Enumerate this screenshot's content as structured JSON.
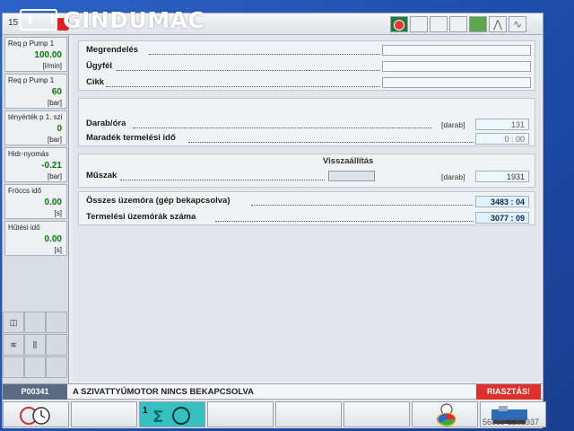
{
  "brand": {
    "logo_text": "GINDUMAC"
  },
  "topbar": {
    "time": "15"
  },
  "sidebar": {
    "items": [
      {
        "label": "Req p Pump 1",
        "value": "100.00",
        "unit": "[l/min]"
      },
      {
        "label": "Req p Pump 1",
        "value": "60",
        "unit": "[bar]"
      },
      {
        "label": "tényérték p 1. szi",
        "value": "0",
        "unit": "[bar]"
      },
      {
        "label": "Hidr-nyomás",
        "value": "-0.21",
        "unit": "[bar]"
      },
      {
        "label": "Fröccs idő",
        "value": "0.00",
        "unit": "[s]"
      },
      {
        "label": "Hűtési idő",
        "value": "0.00",
        "unit": "[s]"
      }
    ]
  },
  "main": {
    "order": {
      "megrendeles": "Megrendelés",
      "ugyfel": "Ügyfél",
      "cikk": "Cikk"
    },
    "production": {
      "darab_ora_label": "Darab/óra",
      "darab_ora_unit": "[darab]",
      "darab_ora_value": "131",
      "maradek_label": "Maradék termelési idő",
      "maradek_value": "0 : 00"
    },
    "shift": {
      "reset_label": "Visszaállítás",
      "muszak_label": "Műszak",
      "muszak_unit": "[darab]",
      "muszak_value": "1931"
    },
    "hours": {
      "osszes_label": "Összes üzemóra (gép bekapcsolva)",
      "osszes_value": "3483 : 04",
      "termelesi_label": "Termelési üzemórák száma",
      "termelesi_value": "3077 : 09"
    }
  },
  "status": {
    "code": "P00341",
    "message": "A SZIVATTYÚMOTOR NINCS BEKAPCSOLVA",
    "reset_button": "RIASZTÁS!"
  },
  "fkeys": {
    "active_number": "1"
  },
  "watermark": "56889-2262937"
}
